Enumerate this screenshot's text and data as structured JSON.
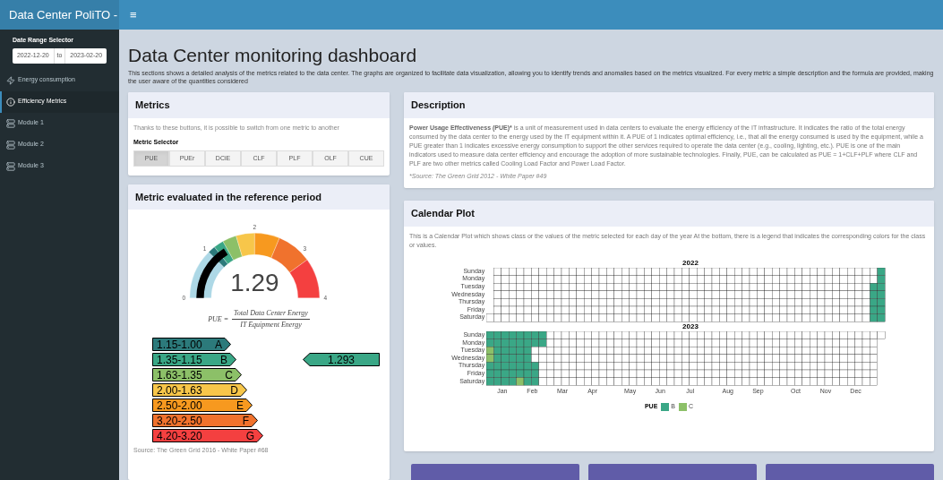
{
  "header": {
    "brand": "Data Center PoliTO -",
    "menu_toggle": "≡"
  },
  "sidebar": {
    "date_range": {
      "label": "Date Range Selector",
      "start": "2022-12-20",
      "separator": "to",
      "end": "2023-02-20"
    },
    "items": [
      {
        "label": "Energy consumption",
        "kind": "bolt",
        "selected": false
      },
      {
        "label": "Efficiency Metrics",
        "kind": "info",
        "selected": true
      },
      {
        "label": "Module 1",
        "kind": "server",
        "selected": false
      },
      {
        "label": "Module 2",
        "kind": "server",
        "selected": false
      },
      {
        "label": "Module 3",
        "kind": "server",
        "selected": false
      }
    ]
  },
  "page": {
    "title": "Data Center monitoring dashboard",
    "intro": "This sections shows a detailed analysis of the metrics related to the data center. The graphs are organized to facilitate data visualization, allowing you to identify trends and anomalies based on the metrics visualized. For every metric a simple description and the formula are provided, making the user aware of the quantities considered"
  },
  "metrics": {
    "title": "Metrics",
    "text": "Thanks to these buttons, it is possible to switch from one metric to another",
    "selector_label": "Metric Selector",
    "buttons": [
      {
        "label": "PUE",
        "selected": true
      },
      {
        "label": "PUEr",
        "selected": false
      },
      {
        "label": "DCiE",
        "selected": false
      },
      {
        "label": "CLF",
        "selected": false
      },
      {
        "label": "PLF",
        "selected": false
      },
      {
        "label": "OLF",
        "selected": false
      },
      {
        "label": "CUE",
        "selected": false
      }
    ]
  },
  "reference": {
    "title": "Metric evaluated in the reference period",
    "gauge": {
      "value": "1.29",
      "ticks": [
        "0",
        "1",
        "2",
        "3",
        "4"
      ]
    },
    "formula": {
      "lhs": "PUE =",
      "numerator": "Total Data Center Energy",
      "denominator": "IT Equipment Energy"
    },
    "classes": [
      {
        "range": "1.15-1.00",
        "letter": "A",
        "color": "#2c7a7b"
      },
      {
        "range": "1.35-1.15",
        "letter": "B",
        "color": "#3aa786"
      },
      {
        "range": "1.63-1.35",
        "letter": "C",
        "color": "#8cc068"
      },
      {
        "range": "2.00-1.63",
        "letter": "D",
        "color": "#f7c64a"
      },
      {
        "range": "2.50-2.00",
        "letter": "E",
        "color": "#f7991f"
      },
      {
        "range": "3.20-2.50",
        "letter": "F",
        "color": "#f0722d"
      },
      {
        "range": "4.20-3.20",
        "letter": "G",
        "color": "#f44040"
      }
    ],
    "pointer": {
      "value": "1.293",
      "color": "#3aa786"
    },
    "source": "Source: The Green Grid 2016 - White Paper #68"
  },
  "description": {
    "title": "Description",
    "term": "Power Usage Effectiveness (PUE)*",
    "text": " is a unit of measurement used in data centers to evaluate the energy efficiency of the IT infrastructure. It indicates the ratio of the total energy consumed by the data center to the energy used by the IT equipment within it. A PUE of 1 indicates optimal efficiency, i.e., that all the energy consumed is used by the equipment, while a PUE greater than 1 indicates excessive energy consumption to support the other services required to operate the data center (e.g., cooling, lighting, etc.). PUE is one of the main indicators used to measure data center efficiency and encourage the adoption of more sustainable technologies. Finally, PUE, can be calculated as PUE = 1+CLF+PLF where CLF and PLF are two other metrics called Cooling Load Factor and Power Load Factor.",
    "source": "*Source: The Green Grid 2012 - White Paper #49"
  },
  "calendar": {
    "title": "Calendar Plot",
    "text": "This is a Calendar Plot which shows class or the values of the metric selected for each day of the year At the bottom, there is a legend that indicates the corresponding colors for the class or values.",
    "years": [
      {
        "year": "2022",
        "weekdays": [
          "Sunday",
          "Monday",
          "Tuesday",
          "Wednesday",
          "Thursday",
          "Friday",
          "Saturday"
        ]
      },
      {
        "year": "2023",
        "weekdays": [
          "Sunday",
          "Monday",
          "Tuesday",
          "Wednesday",
          "Thursday",
          "Friday",
          "Saturday"
        ]
      }
    ],
    "months": [
      "Jan",
      "Feb",
      "Mar",
      "Apr",
      "May",
      "Jun",
      "Jul",
      "Aug",
      "Sep",
      "Oct",
      "Nov",
      "Dec"
    ],
    "legend": {
      "title": "PUE",
      "items": [
        {
          "label": "B",
          "color": "#3aa786"
        },
        {
          "label": "C",
          "color": "#8cc068"
        }
      ]
    }
  }
}
